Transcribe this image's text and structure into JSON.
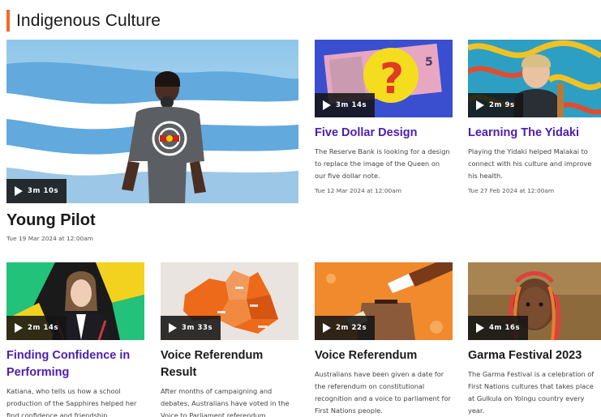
{
  "section": {
    "title": "Indigenous Culture",
    "accent_color": "#f26b21"
  },
  "hero": {
    "title": "Young Pilot",
    "duration": "3m 10s",
    "date": "Tue 19 Mar 2024 at 12:00am"
  },
  "top_cards": [
    {
      "title": "Five Dollar Design",
      "duration": "3m 14s",
      "description": "The Reserve Bank is looking for a design to replace the image of the Queen on our five dollar note.",
      "date": "Tue 12 Mar 2024 at 12:00am"
    },
    {
      "title": "Learning The Yidaki",
      "duration": "2m 9s",
      "description": "Playing the Yidaki helped Malakai to connect with his culture and improve his health.",
      "date": "Tue 27 Feb 2024 at 12:00am"
    }
  ],
  "bottom_cards": [
    {
      "title": "Finding Confidence in Performing",
      "duration": "2m 14s",
      "description": "Katiana, who tells us how a school production of the Sapphires helped her find confidence and friendship."
    },
    {
      "title": "Voice Referendum Result",
      "duration": "3m 33s",
      "description": "After months of campaigning and debates, Australians have voted in the Voice to Parliament referendum."
    },
    {
      "title": "Voice Referendum",
      "duration": "2m 22s",
      "description": "Australians have been given a date for the referendum on constitutional recognition and a voice to parliament for First Nations people."
    },
    {
      "title": "Garma Festival 2023",
      "duration": "4m 16s",
      "description": "The Garma Festival is a celebration of First Nations cultures that takes place at Gulkula on Yolngu country every year."
    }
  ],
  "colors": {
    "link_purple": "#4a1eb2",
    "overlay": "#141414"
  }
}
